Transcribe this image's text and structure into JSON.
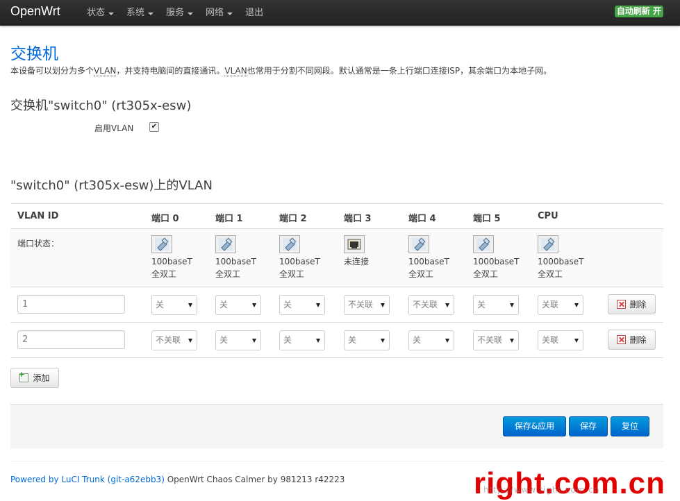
{
  "app": {
    "brand": "OpenWrt",
    "nav": [
      {
        "label": "状态",
        "dropdown": true
      },
      {
        "label": "系统",
        "dropdown": true
      },
      {
        "label": "服务",
        "dropdown": true
      },
      {
        "label": "网络",
        "dropdown": true
      },
      {
        "label": "退出",
        "dropdown": false
      }
    ],
    "auto_refresh": "自动刷新 开"
  },
  "page": {
    "title": "交换机",
    "description_parts": [
      "本设备可以划分为多个",
      "VLAN",
      "，并支持电脑间的直接通讯。",
      "VLAN",
      "也常用于分割不同网段。默认通常是一条上行端口连接ISP，其余端口为本地子网。"
    ]
  },
  "switch_section": {
    "title": "交换机\"switch0\" (rt305x-esw)",
    "enable_vlan_label": "启用VLAN",
    "enable_vlan_checked": true
  },
  "vlan_section": {
    "title": "\"switch0\" (rt305x-esw)上的VLAN",
    "headers": [
      "VLAN ID",
      "端口 0",
      "端口 1",
      "端口 2",
      "端口 3",
      "端口 4",
      "端口 5",
      "CPU"
    ],
    "port_status_label": "端口状态：",
    "ports": [
      {
        "line1": "100baseT",
        "line2": "全双工",
        "connected": true
      },
      {
        "line1": "100baseT",
        "line2": "全双工",
        "connected": true
      },
      {
        "line1": "100baseT",
        "line2": "全双工",
        "connected": true
      },
      {
        "line1": "未连接",
        "line2": "",
        "connected": false
      },
      {
        "line1": "100baseT",
        "line2": "全双工",
        "connected": true
      },
      {
        "line1": "1000baseT",
        "line2": "全双工",
        "connected": true
      },
      {
        "line1": "1000baseT",
        "line2": "全双工",
        "connected": true
      }
    ],
    "rows": [
      {
        "vlan_id": "1",
        "ports": [
          "关",
          "关",
          "关",
          "不关联",
          "不关联",
          "关",
          "关联"
        ]
      },
      {
        "vlan_id": "2",
        "ports": [
          "不关联",
          "关",
          "关",
          "关",
          "关",
          "不关联",
          "关联"
        ]
      }
    ],
    "delete_label": "删除",
    "add_label": "添加"
  },
  "actions": {
    "save_apply": "保存&应用",
    "save": "保存",
    "reset": "复位"
  },
  "footer": {
    "link_text": "Powered by LuCI Trunk (git-a62ebb3)",
    "rest": " OpenWrt Chaos Calmer by 981213 r42223"
  },
  "watermark": {
    "main": "right.com.cn",
    "sub": "http://www.right.com.cn"
  },
  "colors": {
    "link": "#0069d6",
    "primary_button": "#0064cd",
    "topbar": "#222222",
    "badge": "#46a546",
    "watermark": "#e00000"
  },
  "icons": {
    "port_connected": "ethernet-port-icon",
    "port_disconnected": "ethernet-port-down-icon",
    "delete": "delete-icon",
    "add": "add-icon"
  }
}
